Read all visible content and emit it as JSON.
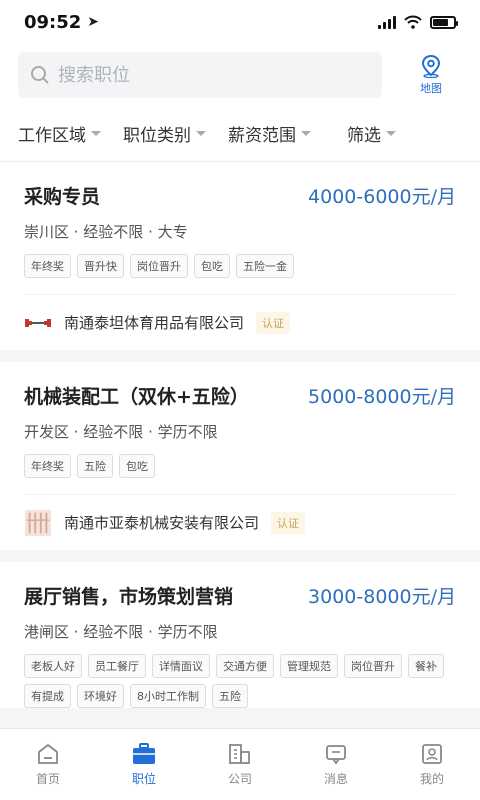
{
  "status": {
    "time": "09:52"
  },
  "search": {
    "placeholder": "搜索职位"
  },
  "map": {
    "label": "地图"
  },
  "filters": [
    "工作区域",
    "职位类别",
    "薪资范围",
    "筛选"
  ],
  "jobs": [
    {
      "title": "采购专员",
      "salary": "4000-6000元/月",
      "meta": "崇川区 · 经验不限 · 大专",
      "tags": [
        "年终奖",
        "晋升快",
        "岗位晋升",
        "包吃",
        "五险一金"
      ],
      "company": "南通泰坦体育用品有限公司",
      "verify": "认证"
    },
    {
      "title": "机械装配工（双休+五险）",
      "salary": "5000-8000元/月",
      "meta": "开发区 · 经验不限 · 学历不限",
      "tags": [
        "年终奖",
        "五险",
        "包吃"
      ],
      "company": "南通市亚泰机械安装有限公司",
      "verify": "认证"
    },
    {
      "title": "展厅销售，市场策划营销",
      "salary": "3000-8000元/月",
      "meta": "港闸区 · 经验不限 · 学历不限",
      "tags": [
        "老板人好",
        "员工餐厅",
        "详情面议",
        "交通方便",
        "管理规范",
        "岗位晋升",
        "餐补",
        "有提成",
        "环境好",
        "8小时工作制",
        "五险"
      ],
      "company": "",
      "verify": ""
    }
  ],
  "tabs": [
    {
      "label": "首页",
      "icon": "home-icon"
    },
    {
      "label": "职位",
      "icon": "briefcase-icon"
    },
    {
      "label": "公司",
      "icon": "building-icon"
    },
    {
      "label": "消息",
      "icon": "message-icon"
    },
    {
      "label": "我的",
      "icon": "profile-icon"
    }
  ],
  "colors": {
    "accent": "#1f6fd6",
    "salary": "#2f6fb8",
    "verify": "#c7a35a"
  }
}
